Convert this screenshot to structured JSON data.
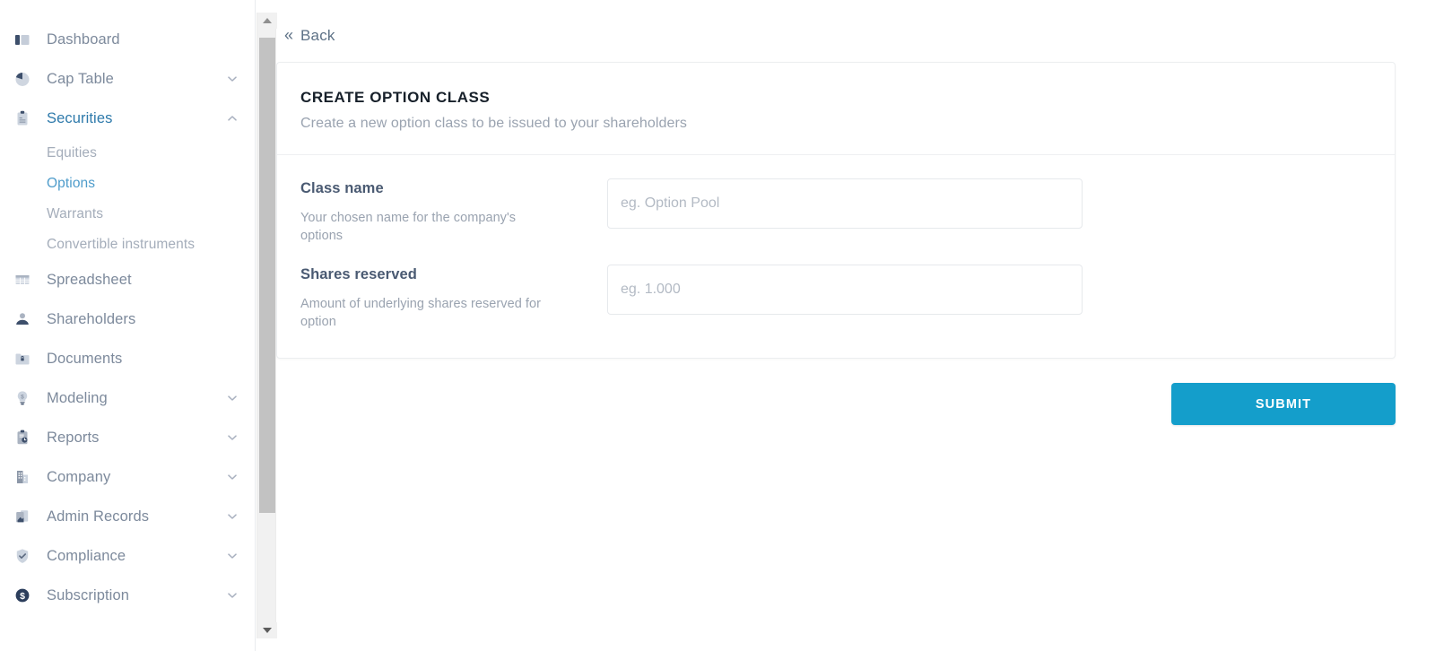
{
  "sidebar": {
    "items": [
      {
        "label": "Dashboard",
        "icon": "dashboard-icon",
        "expandable": false,
        "active": false
      },
      {
        "label": "Cap Table",
        "icon": "pie-chart-icon",
        "expandable": true,
        "expanded": false,
        "active": false
      },
      {
        "label": "Securities",
        "icon": "clipboard-icon",
        "expandable": true,
        "expanded": true,
        "active": true,
        "children": [
          {
            "label": "Equities",
            "active": false
          },
          {
            "label": "Options",
            "active": true
          },
          {
            "label": "Warrants",
            "active": false
          },
          {
            "label": "Convertible instruments",
            "active": false
          }
        ]
      },
      {
        "label": "Spreadsheet",
        "icon": "table-grid-icon",
        "expandable": false,
        "active": false
      },
      {
        "label": "Shareholders",
        "icon": "person-icon",
        "expandable": false,
        "active": false
      },
      {
        "label": "Documents",
        "icon": "locked-folder-icon",
        "expandable": false,
        "active": false
      },
      {
        "label": "Modeling",
        "icon": "lightbulb-dollar-icon",
        "expandable": true,
        "expanded": false,
        "active": false
      },
      {
        "label": "Reports",
        "icon": "report-clipboard-icon",
        "expandable": true,
        "expanded": false,
        "active": false
      },
      {
        "label": "Company",
        "icon": "building-icon",
        "expandable": true,
        "expanded": false,
        "active": false
      },
      {
        "label": "Admin Records",
        "icon": "records-icon",
        "expandable": true,
        "expanded": false,
        "active": false
      },
      {
        "label": "Compliance",
        "icon": "shield-check-icon",
        "expandable": true,
        "expanded": false,
        "active": false
      },
      {
        "label": "Subscription",
        "icon": "dollar-circle-icon",
        "expandable": true,
        "expanded": false,
        "active": false
      }
    ]
  },
  "main": {
    "back": {
      "label": "Back",
      "chevron": "«"
    },
    "card": {
      "title": "CREATE OPTION CLASS",
      "subtitle": "Create a new option class to be issued to your shareholders",
      "fields": [
        {
          "label": "Class name",
          "description": "Your chosen name for the company's options",
          "placeholder": "eg. Option Pool",
          "value": ""
        },
        {
          "label": "Shares reserved",
          "description": "Amount of underlying shares reserved for option",
          "placeholder": "eg. 1.000",
          "value": ""
        }
      ]
    },
    "submit_label": "SUBMIT"
  },
  "colors": {
    "accent": "#149ecb",
    "active_nav": "#2e7aab",
    "active_subnav": "#4e9ccb",
    "nav_text": "#7d8a9c",
    "label_text": "#4a5a72",
    "muted_text": "#9aa3b0"
  }
}
